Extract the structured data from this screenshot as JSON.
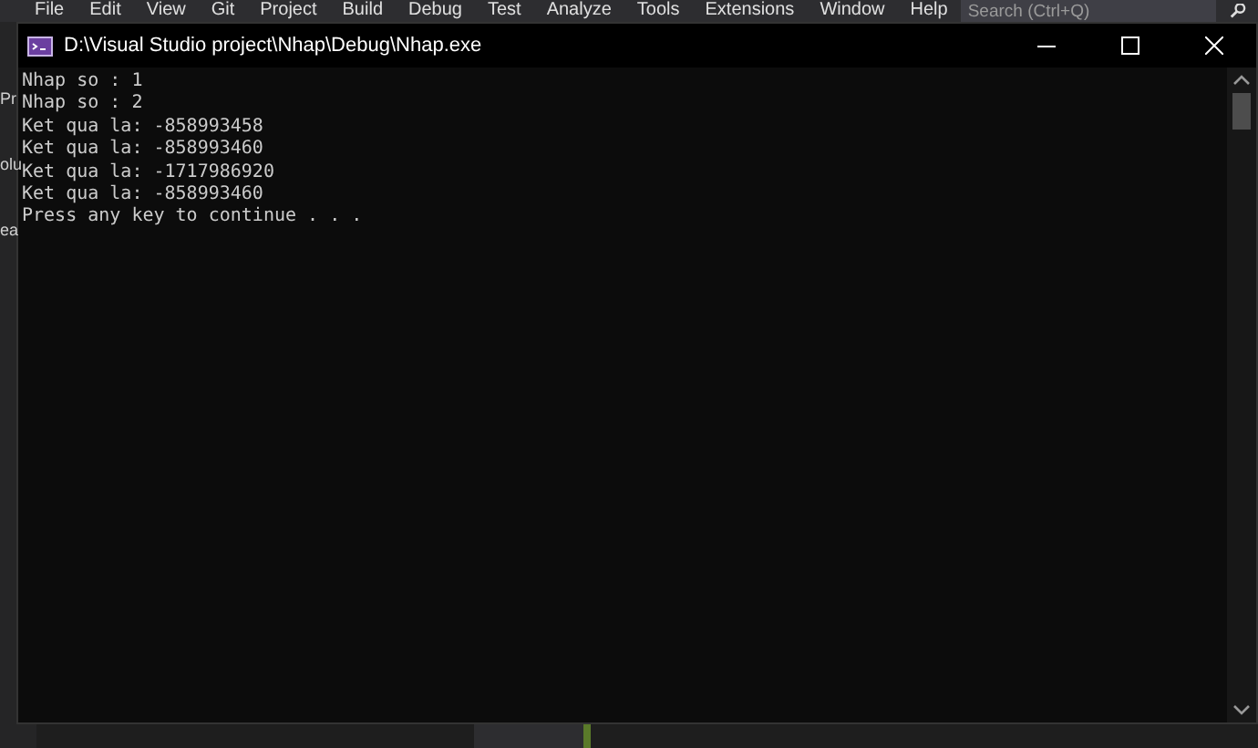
{
  "ide": {
    "menu": [
      "File",
      "Edit",
      "View",
      "Git",
      "Project",
      "Build",
      "Debug",
      "Test",
      "Analyze",
      "Tools",
      "Extensions",
      "Window",
      "Help"
    ],
    "search": {
      "placeholder": "Search (Ctrl+Q)"
    },
    "side_labels": [
      "Pr",
      "olu",
      "ea"
    ]
  },
  "console_window": {
    "title": "D:\\Visual Studio project\\Nhap\\Debug\\Nhap.exe",
    "lines": [
      "Nhap so : 1",
      "Nhap so : 2",
      "Ket qua la: -858993458",
      "Ket qua la: -858993460",
      "Ket qua la: -1717986920",
      "Ket qua la: -858993460",
      "Press any key to continue . . ."
    ]
  }
}
